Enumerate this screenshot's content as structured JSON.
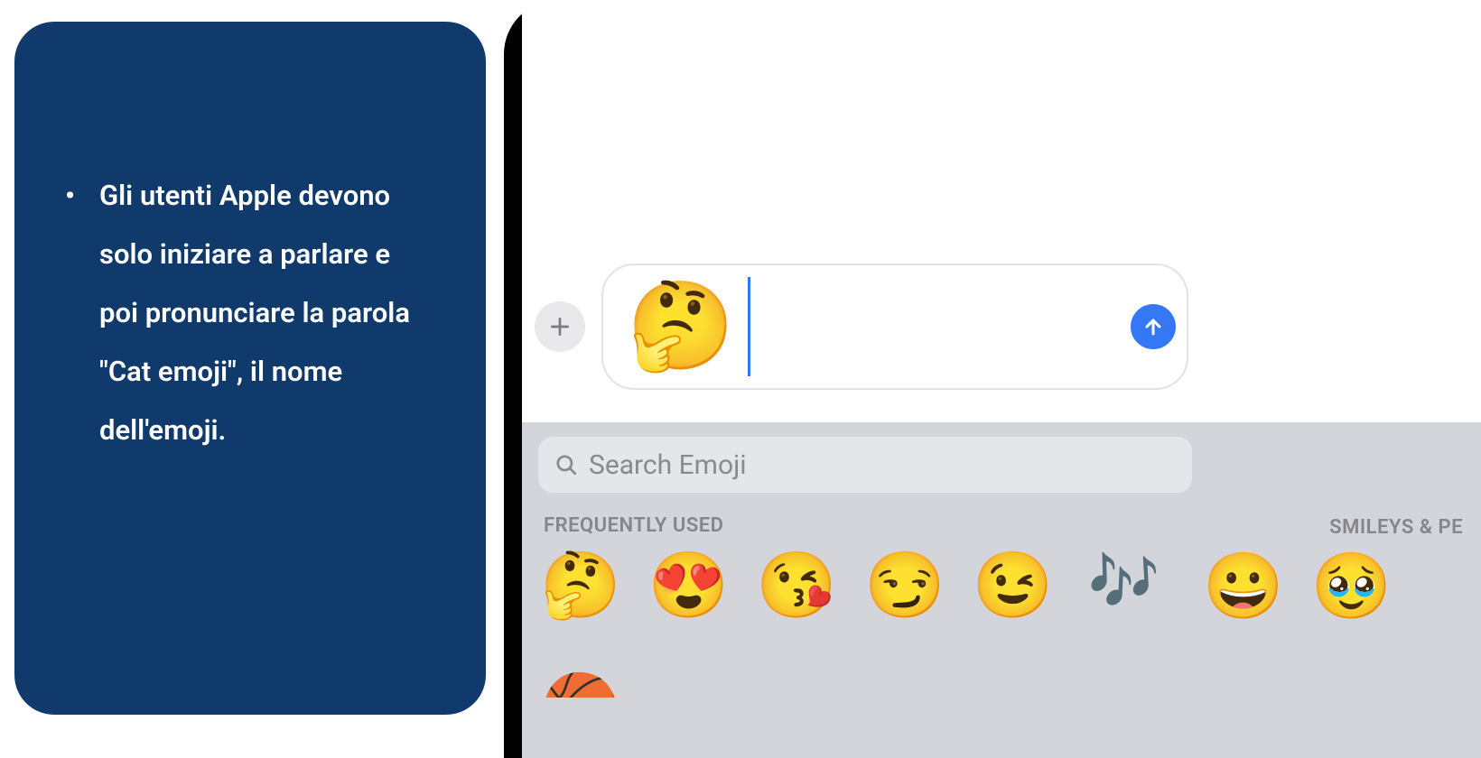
{
  "sidebar": {
    "bullet_text": "Gli utenti Apple devono solo iniziare a parlare e poi pronunciare la parola \"Cat emoji\", il nome dell'emoji."
  },
  "compose": {
    "typed_emoji": "🤔"
  },
  "keyboard": {
    "search_placeholder": "Search Emoji",
    "section_frequent": "FREQUENTLY USED",
    "section_smileys": "SMILEYS & PE",
    "frequent_row1": [
      "🤔",
      "😍",
      "😘",
      "😏",
      "😉"
    ],
    "music_notes": "🎶",
    "frequent_row2_partial": [
      "🏀"
    ],
    "smileys_row1": [
      "😀",
      "🥹"
    ]
  }
}
